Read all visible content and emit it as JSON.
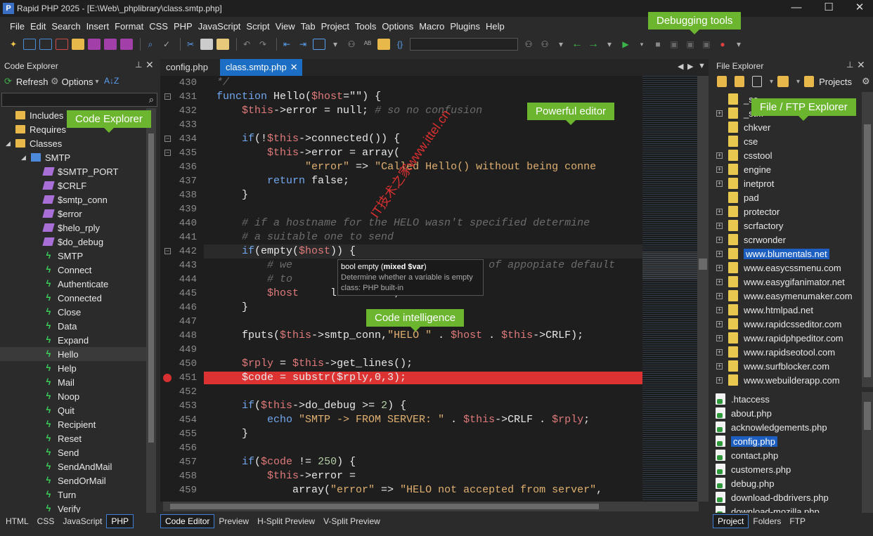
{
  "window": {
    "title": "Rapid PHP 2025 - [E:\\Web\\_phplibrary\\class.smtp.php]",
    "min": "—",
    "max": "☐",
    "close": "✕"
  },
  "menu": [
    "File",
    "Edit",
    "Search",
    "Insert",
    "Format",
    "CSS",
    "PHP",
    "JavaScript",
    "Script",
    "View",
    "Tab",
    "Project",
    "Tools",
    "Options",
    "Macro",
    "Plugins",
    "Help"
  ],
  "callouts": {
    "debugging": "Debugging tools",
    "code_explorer": "Code Explorer",
    "editor": "Powerful editor",
    "file_explorer": "File / FTP Explorer",
    "intelligence": "Code intelligence"
  },
  "code_explorer": {
    "title": "Code Explorer",
    "refresh": "Refresh",
    "options": "Options",
    "search_placeholder": "",
    "items": [
      {
        "label": "Includes",
        "kind": "folder",
        "indent": 0
      },
      {
        "label": "Requires",
        "kind": "folder",
        "indent": 0
      },
      {
        "label": "Classes",
        "kind": "folder",
        "indent": 0
      },
      {
        "label": "SMTP",
        "kind": "class",
        "indent": 1
      },
      {
        "label": "$SMTP_PORT",
        "kind": "prop",
        "indent": 2
      },
      {
        "label": "$CRLF",
        "kind": "prop",
        "indent": 2
      },
      {
        "label": "$smtp_conn",
        "kind": "prop",
        "indent": 2
      },
      {
        "label": "$error",
        "kind": "prop",
        "indent": 2
      },
      {
        "label": "$helo_rply",
        "kind": "prop",
        "indent": 2
      },
      {
        "label": "$do_debug",
        "kind": "prop",
        "indent": 2
      },
      {
        "label": "SMTP",
        "kind": "meth",
        "indent": 2
      },
      {
        "label": "Connect",
        "kind": "meth",
        "indent": 2
      },
      {
        "label": "Authenticate",
        "kind": "meth",
        "indent": 2
      },
      {
        "label": "Connected",
        "kind": "meth",
        "indent": 2
      },
      {
        "label": "Close",
        "kind": "meth",
        "indent": 2
      },
      {
        "label": "Data",
        "kind": "meth",
        "indent": 2
      },
      {
        "label": "Expand",
        "kind": "meth",
        "indent": 2
      },
      {
        "label": "Hello",
        "kind": "meth",
        "indent": 2
      },
      {
        "label": "Help",
        "kind": "meth",
        "indent": 2
      },
      {
        "label": "Mail",
        "kind": "meth",
        "indent": 2
      },
      {
        "label": "Noop",
        "kind": "meth",
        "indent": 2
      },
      {
        "label": "Quit",
        "kind": "meth",
        "indent": 2
      },
      {
        "label": "Recipient",
        "kind": "meth",
        "indent": 2
      },
      {
        "label": "Reset",
        "kind": "meth",
        "indent": 2
      },
      {
        "label": "Send",
        "kind": "meth",
        "indent": 2
      },
      {
        "label": "SendAndMail",
        "kind": "meth",
        "indent": 2
      },
      {
        "label": "SendOrMail",
        "kind": "meth",
        "indent": 2
      },
      {
        "label": "Turn",
        "kind": "meth",
        "indent": 2
      },
      {
        "label": "Verify",
        "kind": "meth",
        "indent": 2
      }
    ],
    "bottom_tabs": [
      "HTML",
      "CSS",
      "JavaScript",
      "PHP"
    ],
    "bottom_active": "PHP"
  },
  "editor": {
    "tabs": [
      "config.php",
      "class.smtp.php"
    ],
    "active_tab": "class.smtp.php",
    "bottom_tabs": [
      "Code Editor",
      "Preview",
      "H-Split Preview",
      "V-Split Preview"
    ],
    "bottom_active": "Code Editor",
    "highlight_line": "451",
    "tooltip": {
      "sig_pre": "bool empty (",
      "sig_param": "mixed $var",
      "sig_post": ")",
      "desc": "Determine whether a variable is empty",
      "cls": "class: PHP built-in"
    }
  },
  "code": [
    {
      "n": "430",
      "t": [
        [
          "c",
          "  */"
        ]
      ]
    },
    {
      "n": "431",
      "t": [
        [
          "k",
          "  function "
        ],
        [
          "t",
          "Hello("
        ],
        [
          "v",
          "$host"
        ],
        [
          "t",
          "=\"\") {"
        ]
      ]
    },
    {
      "n": "432",
      "t": [
        [
          "v",
          "      $this"
        ],
        [
          "t",
          "->error = null; "
        ],
        [
          "c",
          "# so no confusion"
        ]
      ]
    },
    {
      "n": "433",
      "t": []
    },
    {
      "n": "434",
      "t": [
        [
          "k",
          "      if"
        ],
        [
          "t",
          "(!"
        ],
        [
          "v",
          "$this"
        ],
        [
          "t",
          "->connected()) {"
        ]
      ]
    },
    {
      "n": "435",
      "t": [
        [
          "v",
          "          $this"
        ],
        [
          "t",
          "->error = array("
        ]
      ]
    },
    {
      "n": "436",
      "t": [
        [
          "s",
          "                \"error\""
        ],
        [
          "t",
          " => "
        ],
        [
          "s",
          "\"Called Hello() without being conne"
        ]
      ]
    },
    {
      "n": "437",
      "t": [
        [
          "k",
          "          return "
        ],
        [
          "t",
          "false;"
        ]
      ]
    },
    {
      "n": "438",
      "t": [
        [
          "t",
          "      }"
        ]
      ]
    },
    {
      "n": "439",
      "t": []
    },
    {
      "n": "440",
      "t": [
        [
          "c",
          "      # if a hostname for the HELO wasn't specified determine"
        ]
      ]
    },
    {
      "n": "441",
      "t": [
        [
          "c",
          "      # a suitable one to send"
        ]
      ]
    },
    {
      "n": "442",
      "t": [
        [
          "k",
          "      if"
        ],
        [
          "t",
          "(empty("
        ],
        [
          "v",
          "$host"
        ],
        [
          "t",
          ")) {"
        ]
      ]
    },
    {
      "n": "443",
      "t": [
        [
          "c",
          "          # we                          sort of appopiate default"
        ]
      ]
    },
    {
      "n": "444",
      "t": [
        [
          "c",
          "          # to"
        ]
      ]
    },
    {
      "n": "445",
      "t": [
        [
          "v",
          "          $host"
        ],
        [
          "t",
          "     localhost\";"
        ]
      ]
    },
    {
      "n": "446",
      "t": [
        [
          "t",
          "      }"
        ]
      ]
    },
    {
      "n": "447",
      "t": []
    },
    {
      "n": "448",
      "t": [
        [
          "t",
          "      fputs("
        ],
        [
          "v",
          "$this"
        ],
        [
          "t",
          "->smtp_conn,"
        ],
        [
          "s",
          "\"HELO \""
        ],
        [
          "t",
          " . "
        ],
        [
          "v",
          "$host"
        ],
        [
          "t",
          " . "
        ],
        [
          "v",
          "$this"
        ],
        [
          "t",
          "->CRLF);"
        ]
      ]
    },
    {
      "n": "449",
      "t": []
    },
    {
      "n": "450",
      "t": [
        [
          "v",
          "      $rply"
        ],
        [
          "t",
          " = "
        ],
        [
          "v",
          "$this"
        ],
        [
          "t",
          "->get_lines();"
        ]
      ]
    },
    {
      "n": "451",
      "t": [
        [
          "t",
          "      $code = substr($rply,0,3);"
        ]
      ]
    },
    {
      "n": "452",
      "t": []
    },
    {
      "n": "453",
      "t": [
        [
          "k",
          "      if"
        ],
        [
          "t",
          "("
        ],
        [
          "v",
          "$this"
        ],
        [
          "t",
          "->do_debug >= "
        ],
        [
          "n",
          "2"
        ],
        [
          "t",
          ") {"
        ]
      ]
    },
    {
      "n": "454",
      "t": [
        [
          "k",
          "          echo "
        ],
        [
          "s",
          "\"SMTP -> FROM SERVER: \""
        ],
        [
          "t",
          " . "
        ],
        [
          "v",
          "$this"
        ],
        [
          "t",
          "->CRLF . "
        ],
        [
          "v",
          "$rply"
        ],
        [
          "t",
          ";"
        ]
      ]
    },
    {
      "n": "455",
      "t": [
        [
          "t",
          "      }"
        ]
      ]
    },
    {
      "n": "456",
      "t": []
    },
    {
      "n": "457",
      "t": [
        [
          "k",
          "      if"
        ],
        [
          "t",
          "("
        ],
        [
          "v",
          "$code"
        ],
        [
          "t",
          " != "
        ],
        [
          "n",
          "250"
        ],
        [
          "t",
          ") {"
        ]
      ]
    },
    {
      "n": "458",
      "t": [
        [
          "v",
          "          $this"
        ],
        [
          "t",
          "->error ="
        ]
      ]
    },
    {
      "n": "459",
      "t": [
        [
          "t",
          "              array("
        ],
        [
          "s",
          "\"error\""
        ],
        [
          "t",
          " => "
        ],
        [
          "s",
          "\"HELO not accepted from server\""
        ],
        [
          "t",
          ","
        ]
      ]
    }
  ],
  "file_explorer": {
    "title": "File Explorer",
    "projects": "Projects",
    "folders": [
      {
        "label": "_sc...",
        "plus": false
      },
      {
        "label": "_st...",
        "plus": true
      },
      {
        "label": "chkver",
        "plus": false
      },
      {
        "label": "cse",
        "plus": false
      },
      {
        "label": "csstool",
        "plus": true
      },
      {
        "label": "engine",
        "plus": true
      },
      {
        "label": "inetprot",
        "plus": true
      },
      {
        "label": "pad",
        "plus": false
      },
      {
        "label": "protector",
        "plus": true
      },
      {
        "label": "scrfactory",
        "plus": true
      },
      {
        "label": "scrwonder",
        "plus": true
      },
      {
        "label": "www.blumentals.net",
        "plus": true,
        "selected": true
      },
      {
        "label": "www.easycssmenu.com",
        "plus": true
      },
      {
        "label": "www.easygifanimator.net",
        "plus": true
      },
      {
        "label": "www.easymenumaker.com",
        "plus": true
      },
      {
        "label": "www.htmlpad.net",
        "plus": true
      },
      {
        "label": "www.rapidcsseditor.com",
        "plus": true
      },
      {
        "label": "www.rapidphpeditor.com",
        "plus": true
      },
      {
        "label": "www.rapidseotool.com",
        "plus": true
      },
      {
        "label": "www.surfblocker.com",
        "plus": true
      },
      {
        "label": "www.webuilderapp.com",
        "plus": true
      }
    ],
    "files": [
      {
        "label": ".htaccess",
        "selected": false
      },
      {
        "label": "about.php",
        "selected": false
      },
      {
        "label": "acknowledgements.php",
        "selected": false
      },
      {
        "label": "config.php",
        "selected": true
      },
      {
        "label": "contact.php",
        "selected": false
      },
      {
        "label": "customers.php",
        "selected": false
      },
      {
        "label": "debug.php",
        "selected": false
      },
      {
        "label": "download-dbdrivers.php",
        "selected": false
      },
      {
        "label": "download-mozilla.php",
        "selected": false
      }
    ],
    "bottom_tabs": [
      "Project",
      "Folders",
      "FTP"
    ],
    "bottom_active": "Project"
  },
  "watermark": "IT技术之家www.ittel.cn"
}
